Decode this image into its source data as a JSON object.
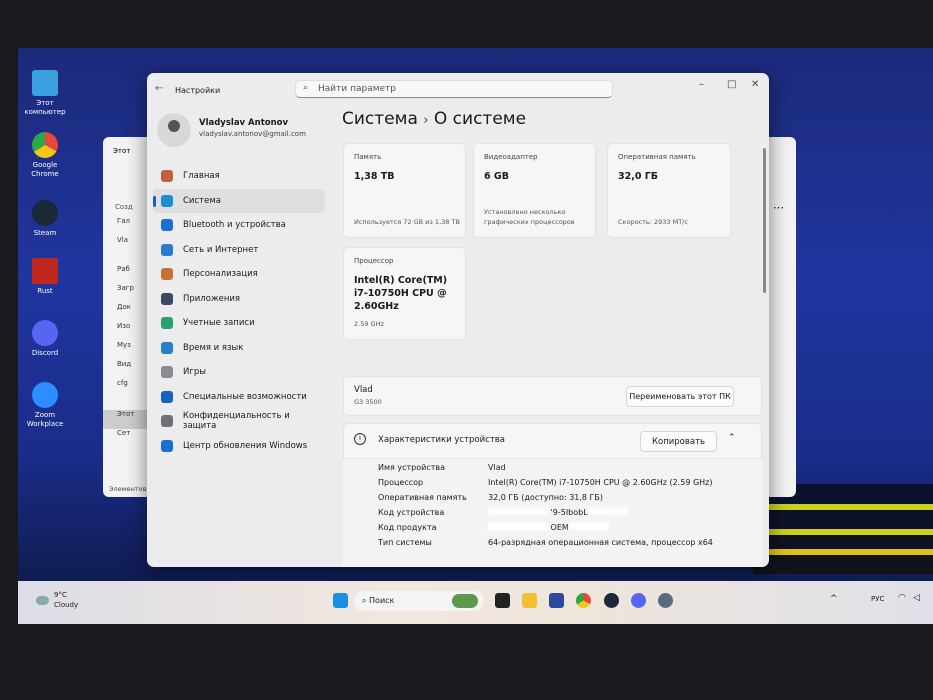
{
  "desktop": {
    "icons": [
      {
        "label": "Этот компьютер",
        "color": "#3aa0e0"
      },
      {
        "label": "Google Chrome",
        "color": "#e8453c"
      },
      {
        "label": "Steam",
        "color": "#1b2838"
      },
      {
        "label": "Rust",
        "color": "#c0281e"
      },
      {
        "label": "Discord",
        "color": "#5865f2"
      },
      {
        "label": "Zoom Workplace",
        "color": "#2d8cff"
      }
    ]
  },
  "explorer": {
    "title": "Этот",
    "create": "Созд",
    "nav": [
      "Гал",
      "Vla",
      "Раб",
      "Загр",
      "Док",
      "Изо",
      "Муз",
      "Вид",
      "cfg",
      "Этот",
      "Сет"
    ],
    "status": "Элементов"
  },
  "settings": {
    "app_title": "Настройки",
    "search_placeholder": "Найти параметр",
    "user": {
      "name": "Vladyslav Antonov",
      "email": "vladyslav.antonov@gmail.com"
    },
    "nav": [
      {
        "label": "Главная",
        "color": "#c4603a"
      },
      {
        "label": "Система",
        "color": "#1a8fd0"
      },
      {
        "label": "Bluetooth и устройства",
        "color": "#1a6fd0"
      },
      {
        "label": "Сеть и Интернет",
        "color": "#2a7ad0"
      },
      {
        "label": "Персонализация",
        "color": "#c8703a"
      },
      {
        "label": "Приложения",
        "color": "#3a4a60"
      },
      {
        "label": "Учетные записи",
        "color": "#2aa070"
      },
      {
        "label": "Время и язык",
        "color": "#2a80c0"
      },
      {
        "label": "Игры",
        "color": "#8a8a90"
      },
      {
        "label": "Специальные возможности",
        "color": "#1a60c0"
      },
      {
        "label": "Конфиденциальность и защита",
        "color": "#707078"
      },
      {
        "label": "Центр обновления Windows",
        "color": "#1a70d0"
      }
    ],
    "breadcrumb": {
      "parent": "Система",
      "sep": "›",
      "current": "О системе"
    },
    "cards": [
      {
        "header": "Память",
        "value": "1,38 TB",
        "footer": "Используется 72 GB из 1,38 TB"
      },
      {
        "header": "Видеоадаптер",
        "value": "6 GB",
        "footer": "Установлено несколько графических процессоров"
      },
      {
        "header": "Оперативная память",
        "value": "32,0 ГБ",
        "footer": "Скорость: 2933 MT/с"
      },
      {
        "header": "Процессор",
        "value": "Intel(R) Core(TM) i7-10750H CPU @ 2.60GHz",
        "footer": "2.59 GHz"
      }
    ],
    "pc": {
      "name": "Vlad",
      "model": "G3 3500",
      "rename_label": "Переименовать этот ПК"
    },
    "specs": {
      "title": "Характеристики устройства",
      "copy_label": "Копировать",
      "rows": [
        {
          "k": "Имя устройства",
          "v": "Vlad"
        },
        {
          "k": "Процессор",
          "v": "Intel(R) Core(TM) i7-10750H CPU @ 2.60GHz (2.59 GHz)"
        },
        {
          "k": "Оперативная память",
          "v": "32,0 ГБ (доступно: 31,8 ГБ)"
        },
        {
          "k": "Код устройства",
          "v": "'9-5IbobL"
        },
        {
          "k": "Код продукта",
          "v": "OEM"
        },
        {
          "k": "Тип системы",
          "v": "64-разрядная операционная система, процессор x64"
        }
      ]
    }
  },
  "taskbar": {
    "weather_temp": "9°C",
    "weather_text": "Cloudy",
    "search_label": "Поиск",
    "lang": "РУС"
  }
}
